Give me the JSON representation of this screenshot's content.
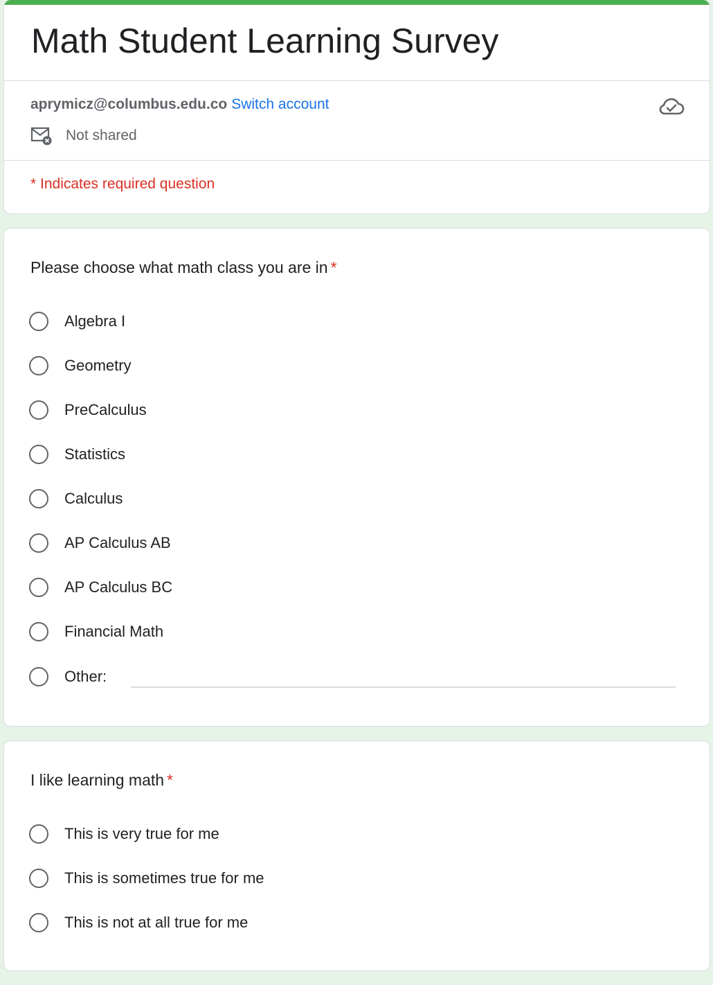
{
  "form": {
    "title": "Math Student Learning Survey",
    "account_email": "aprymicz@columbus.edu.co",
    "switch_account": "Switch account",
    "sharing_status": "Not shared",
    "required_note": "* Indicates required question",
    "accent_color": "#4caf50",
    "icons": [
      "cloud-check-icon",
      "mail-not-shared-icon"
    ]
  },
  "q1": {
    "title": "Please choose what math class you are in",
    "required_mark": "*",
    "options": [
      "Algebra I",
      "Geometry",
      "PreCalculus",
      "Statistics",
      "Calculus",
      "AP Calculus AB",
      "AP Calculus BC",
      "Financial Math",
      "Other:"
    ]
  },
  "q2": {
    "title": "I like learning math",
    "required_mark": "*",
    "options": [
      "This is very true for me",
      "This is sometimes true for me",
      "This is not at all true for me"
    ]
  }
}
